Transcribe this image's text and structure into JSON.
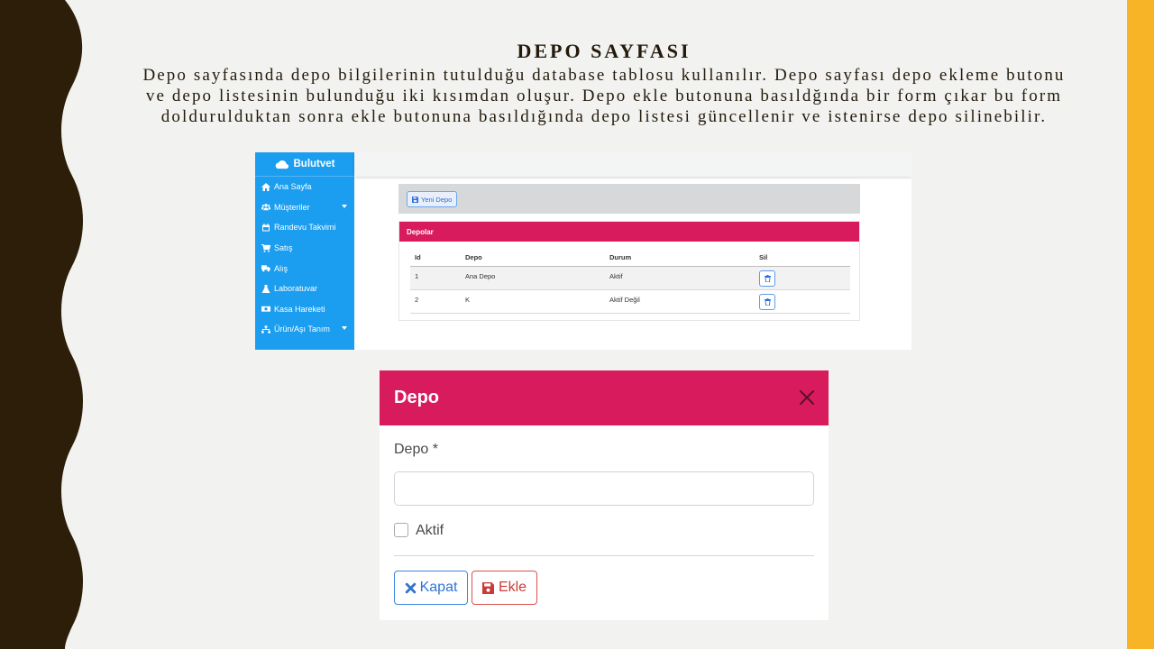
{
  "slide": {
    "title": "DEPO SAYFASI",
    "body": "Depo sayfasında depo bilgilerinin tutulduğu database tablosu kullanılır. Depo sayfası depo ekleme butonu ve depo listesinin bulunduğu iki kısımdan oluşur. Depo ekle butonuna basıldğında bir form çıkar bu form doldurulduktan sonra ekle butonuna basıldığında depo listesi güncellenir ve istenirse depo silinebilir."
  },
  "colors": {
    "accent": "#d81b5c",
    "sidebar": "#1b9df0",
    "side_band": "#2c1e08",
    "right_band": "#f6b426"
  },
  "app": {
    "brand": "Bulutvet",
    "sidebar": {
      "items": [
        {
          "label": "Ana Sayfa",
          "icon": "home-icon"
        },
        {
          "label": "Müşteriler",
          "icon": "users-icon",
          "dropdown": true
        },
        {
          "label": "Randevu Takvimi",
          "icon": "calendar-icon"
        },
        {
          "label": "Satış",
          "icon": "cart-icon"
        },
        {
          "label": "Alış",
          "icon": "truck-icon"
        },
        {
          "label": "Laboratuvar",
          "icon": "flask-icon"
        },
        {
          "label": "Kasa Hareketi",
          "icon": "money-icon"
        },
        {
          "label": "Ürün/Aşı Tanım",
          "icon": "sitemap-icon",
          "dropdown": true
        }
      ]
    },
    "toolbar": {
      "new_label": "Yeni Depo"
    },
    "list": {
      "title": "Depolar",
      "columns": [
        "Id",
        "Depo",
        "Durum",
        "Sil"
      ],
      "rows": [
        {
          "id": "1",
          "depo": "Ana Depo",
          "durum": "Aktif"
        },
        {
          "id": "2",
          "depo": "K",
          "durum": "Aktif Değil"
        }
      ]
    }
  },
  "modal": {
    "title": "Depo",
    "field_label": "Depo *",
    "field_value": "",
    "checkbox_label": "Aktif",
    "checkbox_checked": false,
    "close_label": "Kapat",
    "save_label": "Ekle"
  }
}
